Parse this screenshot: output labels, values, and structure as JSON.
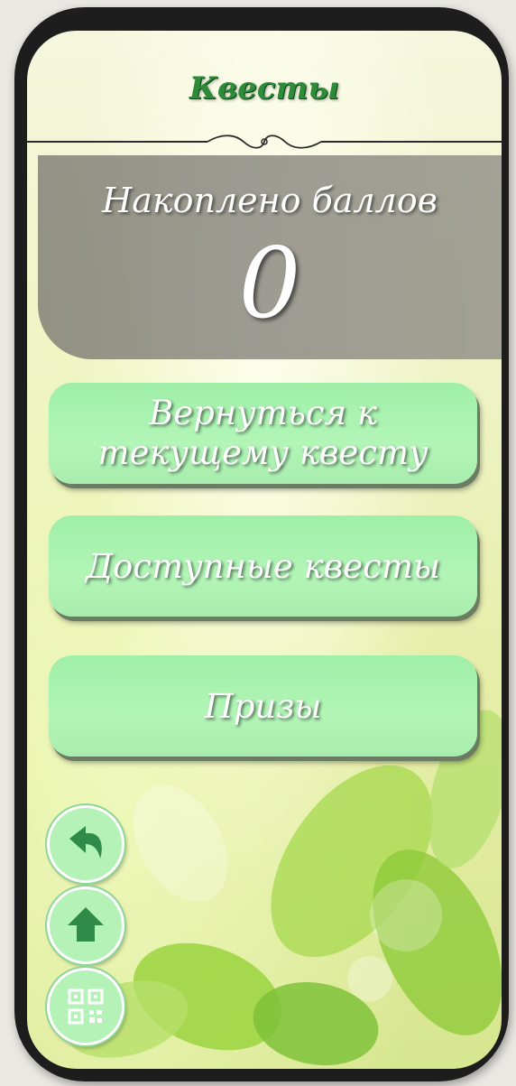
{
  "header": {
    "title": "Квесты"
  },
  "score": {
    "label": "Накоплено баллов",
    "value": "0"
  },
  "menu": {
    "continue_line1": "Вернуться к",
    "continue_line2": "текущему квесту",
    "available": "Доступные квесты",
    "prizes": "Призы"
  },
  "nav": {
    "back_icon": "back-arrow-icon",
    "home_icon": "home-arrow-icon",
    "qr_icon": "qr-code-icon"
  },
  "colors": {
    "title": "#2e8b3a",
    "button": "#a8eeae",
    "panel": "#7f7d78"
  }
}
